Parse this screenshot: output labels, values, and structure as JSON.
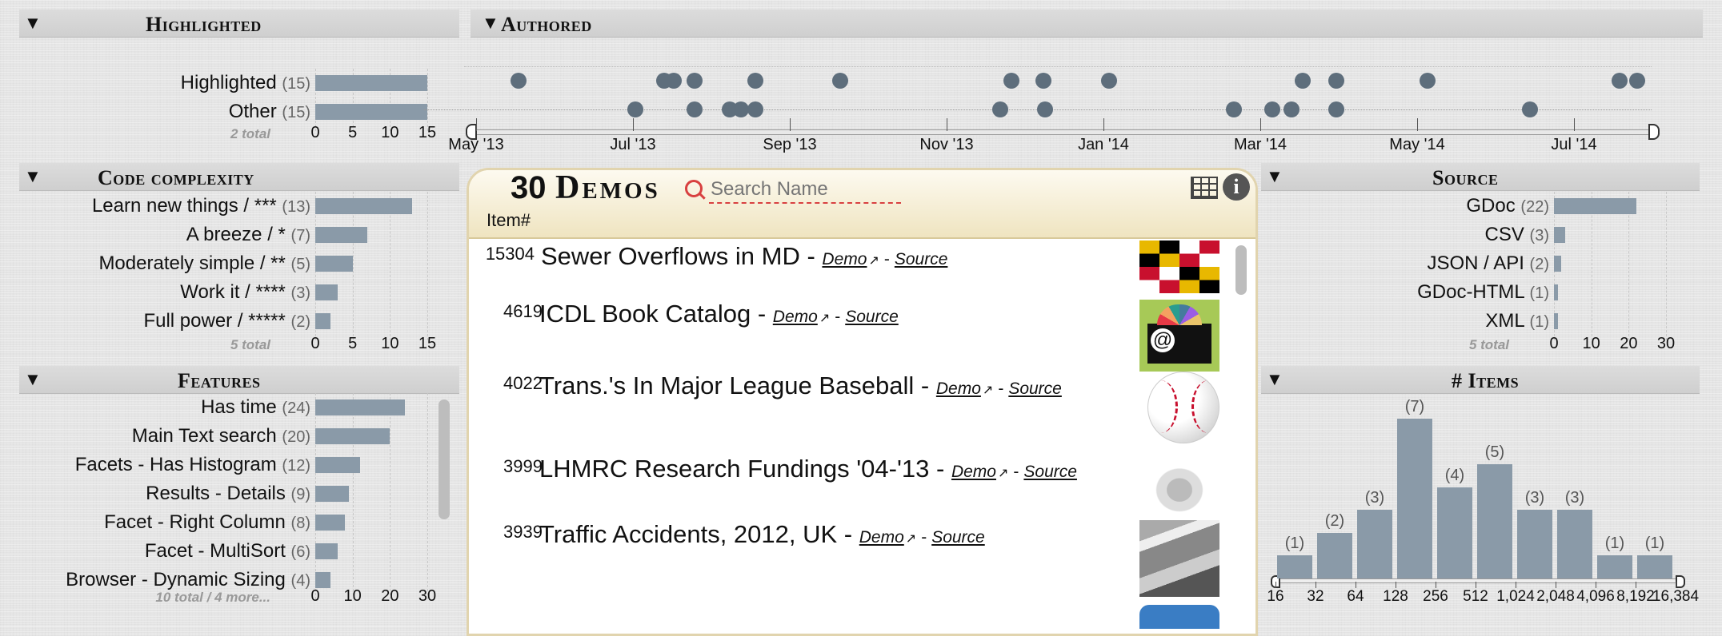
{
  "highlighted": {
    "title": "Highlighted",
    "items": [
      {
        "label": "Highlighted",
        "count": "(15)",
        "value": 15
      },
      {
        "label": "Other",
        "count": "(15)",
        "value": 15
      }
    ],
    "total": "2 total",
    "axis": [
      "0",
      "5",
      "10",
      "15"
    ]
  },
  "authored": {
    "title": "Authored",
    "ticks": [
      "May '13",
      "Jul '13",
      "Sep '13",
      "Nov '13",
      "Jan '14",
      "Mar '14",
      "May '14",
      "Jul '14"
    ]
  },
  "code_complexity": {
    "title": "Code complexity",
    "items": [
      {
        "label": "Learn new things / ***",
        "count": "(13)",
        "value": 13
      },
      {
        "label": "A breeze / *",
        "count": "(7)",
        "value": 7
      },
      {
        "label": "Moderately simple / **",
        "count": "(5)",
        "value": 5
      },
      {
        "label": "Work it / ****",
        "count": "(3)",
        "value": 3
      },
      {
        "label": "Full power / *****",
        "count": "(2)",
        "value": 2
      }
    ],
    "total": "5 total",
    "axis": [
      "0",
      "5",
      "10",
      "15"
    ]
  },
  "features": {
    "title": "Features",
    "items": [
      {
        "label": "Has time",
        "count": "(24)",
        "value": 24
      },
      {
        "label": "Main Text search",
        "count": "(20)",
        "value": 20
      },
      {
        "label": "Facets - Has Histogram",
        "count": "(12)",
        "value": 12
      },
      {
        "label": "Results - Details",
        "count": "(9)",
        "value": 9
      },
      {
        "label": "Facet - Right Column",
        "count": "(8)",
        "value": 8
      },
      {
        "label": "Facet - MultiSort",
        "count": "(6)",
        "value": 6
      },
      {
        "label": "Browser - Dynamic Sizing",
        "count": "(4)",
        "value": 4
      }
    ],
    "total": "10 total / 4 more...",
    "axis": [
      "0",
      "10",
      "20",
      "30"
    ]
  },
  "results": {
    "count": "30",
    "label": "Demos",
    "search_placeholder": "Search Name",
    "column": "Item#",
    "rows": [
      {
        "id": "15304",
        "title": "Sewer Overflows in MD -",
        "demo": "Demo",
        "source": "Source"
      },
      {
        "id": "4619",
        "title": "ICDL Book Catalog -",
        "demo": "Demo",
        "source": "Source"
      },
      {
        "id": "4022",
        "title": "Trans.'s In Major League Baseball -",
        "demo": "Demo",
        "source": "Source"
      },
      {
        "id": "3999",
        "title": "LHMRC Research Fundings '04-'13 -",
        "demo": "Demo",
        "source": "Source"
      },
      {
        "id": "3939",
        "title": "Traffic Accidents, 2012, UK -",
        "demo": "Demo",
        "source": "Source"
      }
    ]
  },
  "source": {
    "title": "Source",
    "items": [
      {
        "label": "GDoc",
        "count": "(22)",
        "value": 22
      },
      {
        "label": "CSV",
        "count": "(3)",
        "value": 3
      },
      {
        "label": "JSON / API",
        "count": "(2)",
        "value": 2
      },
      {
        "label": "GDoc-HTML",
        "count": "(1)",
        "value": 1
      },
      {
        "label": "XML",
        "count": "(1)",
        "value": 1
      }
    ],
    "total": "5 total",
    "axis": [
      "0",
      "10",
      "20",
      "30"
    ]
  },
  "items_hist": {
    "title": "# Items",
    "bins": [
      "16",
      "32",
      "64",
      "128",
      "256",
      "512",
      "1,024",
      "2,048",
      "4,096",
      "8,192",
      "16,384"
    ],
    "counts": [
      1,
      2,
      3,
      7,
      4,
      5,
      3,
      3,
      1,
      1
    ],
    "count_labels": [
      "(1)",
      "(2)",
      "(3)",
      "(7)",
      "(4)",
      "(5)",
      "(3)",
      "(3)",
      "(1)",
      "(1)"
    ]
  },
  "colors": {
    "bar": "#8a9aa8",
    "dot": "#5e6e7c",
    "accent": "#d84040"
  }
}
